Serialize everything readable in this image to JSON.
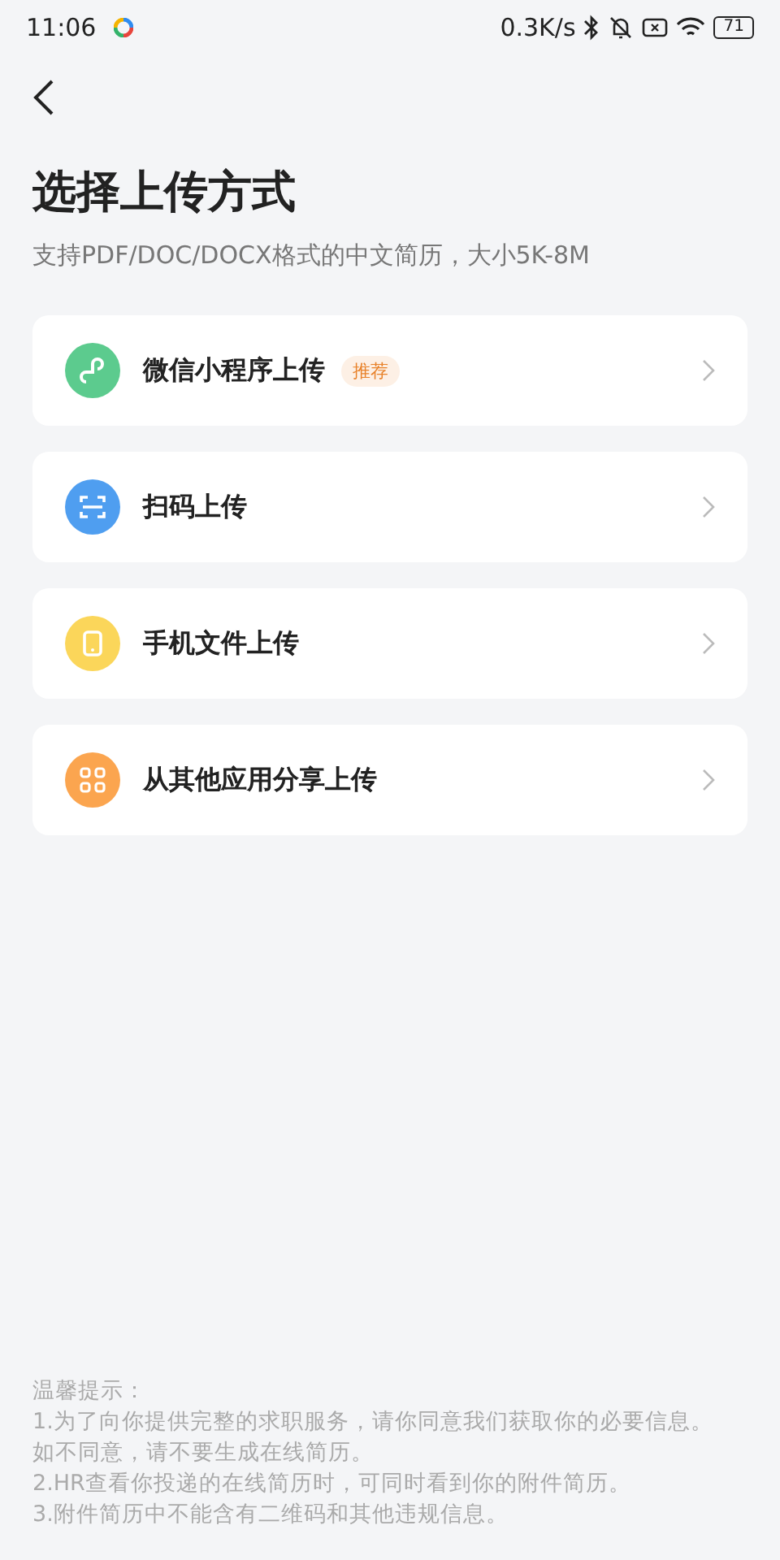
{
  "status_bar": {
    "time": "11:06",
    "speed": "0.3K/s",
    "battery": "71"
  },
  "title": "选择上传方式",
  "subtitle": "支持PDF/DOC/DOCX格式的中文简历，大小5K-8M",
  "options": [
    {
      "kind": "miniprogram",
      "color": "#5ccb8e",
      "label": "微信小程序上传",
      "badge": "推荐"
    },
    {
      "kind": "scan",
      "color": "#4f9ef0",
      "label": "扫码上传"
    },
    {
      "kind": "phone",
      "color": "#fbd65a",
      "label": "手机文件上传"
    },
    {
      "kind": "apps",
      "color": "#fba54f",
      "label": "从其他应用分享上传"
    }
  ],
  "tips": [
    "温馨提示：",
    "1.为了向你提供完整的求职服务，请你同意我们获取你的必要信息。",
    "如不同意，请不要生成在线简历。",
    "2.HR查看你投递的在线简历时，可同时看到你的附件简历。",
    "3.附件简历中不能含有二维码和其他违规信息。"
  ]
}
